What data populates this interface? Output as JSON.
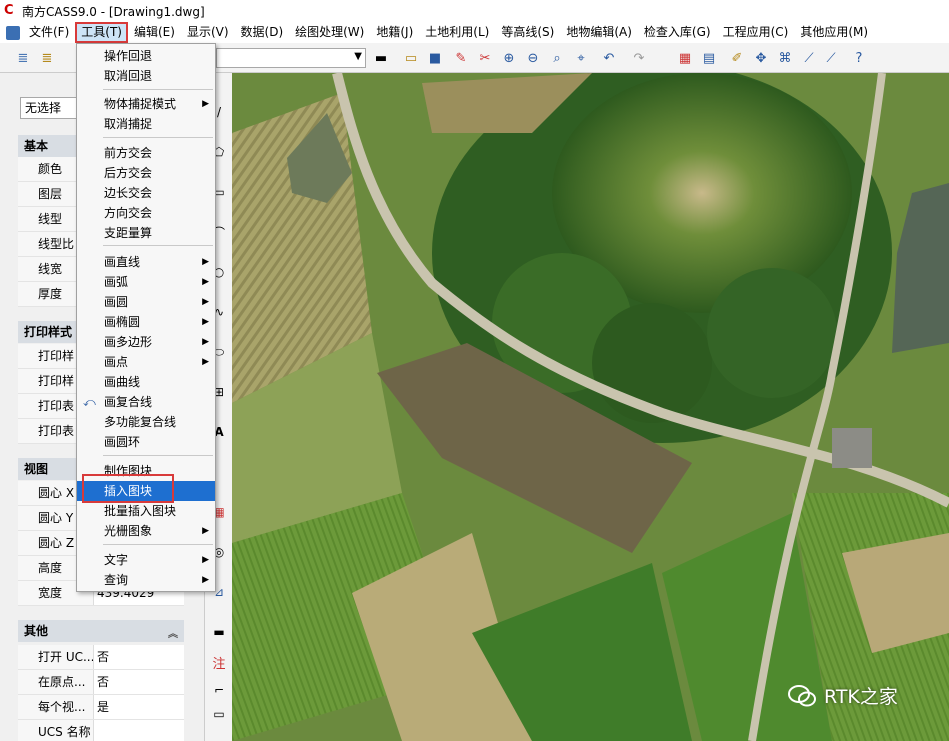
{
  "window": {
    "title": "南方CASS9.0 - [Drawing1.dwg]"
  },
  "menubar": {
    "items": [
      "文件(F)",
      "工具(T)",
      "编辑(E)",
      "显示(V)",
      "数据(D)",
      "绘图处理(W)",
      "地籍(J)",
      "土地利用(L)",
      "等高线(S)",
      "地物编辑(A)",
      "检查入库(G)",
      "工程应用(C)",
      "其他应用(M)"
    ],
    "active": "工具(T)"
  },
  "properties": {
    "selection": "无选择",
    "sections": [
      {
        "title": "基本",
        "rows": [
          "颜色",
          "图层",
          "线型",
          "线型比",
          "线宽",
          "厚度"
        ]
      },
      {
        "title": "打印样式",
        "rows": [
          "打印样",
          "打印样",
          "打印表",
          "打印表"
        ]
      },
      {
        "title": "视图",
        "rows": [
          {
            "k": "圆心 X",
            "v": ""
          },
          {
            "k": "圆心 Y",
            "v": ""
          },
          {
            "k": "圆心 Z",
            "v": ""
          },
          {
            "k": "高度",
            "v": ""
          },
          {
            "k": "宽度",
            "v": "439.4029"
          }
        ]
      },
      {
        "title": "其他",
        "rows": [
          {
            "k": "打开 UC...",
            "v": "否"
          },
          {
            "k": "在原点...",
            "v": "否"
          },
          {
            "k": "每个视...",
            "v": "是"
          },
          {
            "k": "UCS 名称",
            "v": ""
          }
        ]
      }
    ]
  },
  "tools_menu": {
    "items": [
      {
        "label": "操作回退",
        "sub": false
      },
      {
        "label": "取消回退",
        "sub": false
      },
      {
        "sep": true
      },
      {
        "label": "物体捕捉模式",
        "sub": true
      },
      {
        "label": "取消捕捉",
        "sub": false
      },
      {
        "sep": true
      },
      {
        "label": "前方交会",
        "sub": false
      },
      {
        "label": "后方交会",
        "sub": false
      },
      {
        "label": "边长交会",
        "sub": false
      },
      {
        "label": "方向交会",
        "sub": false
      },
      {
        "label": "支距量算",
        "sub": false
      },
      {
        "sep": true
      },
      {
        "label": "画直线",
        "sub": true
      },
      {
        "label": "画弧",
        "sub": true
      },
      {
        "label": "画圆",
        "sub": true
      },
      {
        "label": "画椭圆",
        "sub": true
      },
      {
        "label": "画多边形",
        "sub": true
      },
      {
        "label": "画点",
        "sub": true
      },
      {
        "label": "画曲线",
        "sub": false
      },
      {
        "label": "画复合线",
        "sub": false
      },
      {
        "label": "多功能复合线",
        "sub": false
      },
      {
        "label": "画圆环",
        "sub": false
      },
      {
        "sep": true
      },
      {
        "label": "制作图块",
        "sub": false
      },
      {
        "label": "插入图块",
        "sub": false,
        "highlighted": true
      },
      {
        "label": "批量插入图块",
        "sub": false
      },
      {
        "label": "光栅图象",
        "sub": true
      },
      {
        "sep": true
      },
      {
        "label": "文字",
        "sub": true
      },
      {
        "label": "查询",
        "sub": true
      }
    ]
  },
  "watermark": {
    "text": "RTK之家"
  },
  "colors": {
    "highlight": "#1e6fd0",
    "annotation": "#d83a3a"
  }
}
